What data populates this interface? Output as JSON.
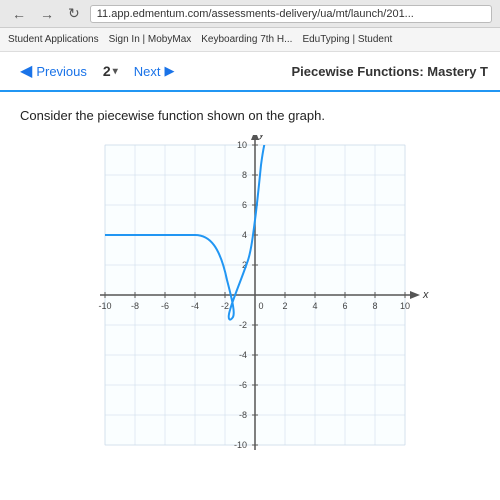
{
  "browser": {
    "url": "11.app.edmentum.com/assessments-delivery/ua/mt/launch/201...",
    "nav_back": "←",
    "nav_forward": "→",
    "nav_reload": "↻",
    "bookmarks": [
      "Student Applications",
      "Sign In | MobyMax",
      "Keyboarding 7th H...",
      "EduTyping | Student"
    ]
  },
  "assessment": {
    "prev_label": "Previous",
    "prev_arrow": "◀",
    "question_number": "2",
    "dropdown_arrow": "▾",
    "next_label": "Next",
    "next_arrow": "▶",
    "title": "Piecewise Functions: Mastery T"
  },
  "question": {
    "text": "Consider the piecewise function shown on the graph."
  },
  "graph": {
    "x_label": "x",
    "y_label": "y",
    "x_min": -10,
    "x_max": 10,
    "y_min": -10,
    "y_max": 10,
    "x_ticks": [
      -10,
      -8,
      -6,
      -4,
      -2,
      0,
      2,
      4,
      6,
      8,
      10
    ],
    "y_ticks": [
      -10,
      -8,
      -6,
      -4,
      -2,
      0,
      2,
      4,
      6,
      8,
      10
    ],
    "tick_labels_x": [
      "-10",
      "-8",
      "-6",
      "-4",
      "-2",
      "",
      "2",
      "4",
      "6",
      "8",
      "10"
    ],
    "tick_labels_y": [
      "-10",
      "-8",
      "-6",
      "-4",
      "-2",
      "",
      "2",
      "4",
      "6",
      "8",
      "10"
    ],
    "curve_description": "piecewise function: flat around y=4 for x<-4, dips to minimum around x=-1 then rises steeply"
  }
}
